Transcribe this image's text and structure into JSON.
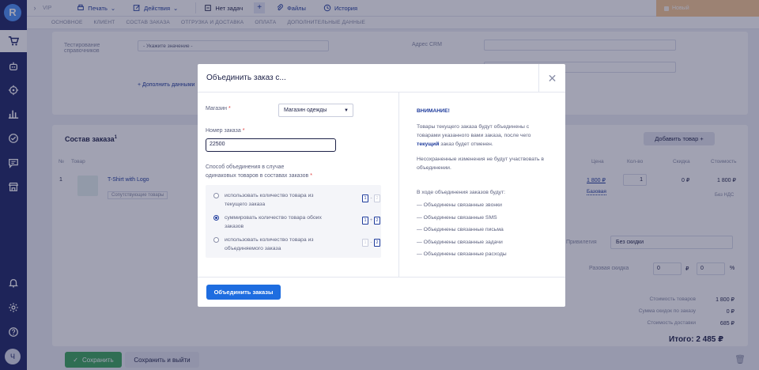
{
  "sidebar": {
    "logo": "R",
    "avatar": "Ч"
  },
  "topbar": {
    "sub_label": "VIP",
    "print_label": "Печать",
    "actions_label": "Действия",
    "tasks_label": "Нет задач",
    "files_label": "Файлы",
    "history_label": "История",
    "status_label": "Новый",
    "status_color": "#f6c993"
  },
  "tabs": [
    "ОСНОВНОЕ",
    "КЛИЕНТ",
    "СОСТАВ ЗАКАЗА",
    "ОТГРУЗКА И ДОСТАВКА",
    "ОПЛАТА",
    "ДОПОЛНИТЕЛЬНЫЕ ДАННЫЕ"
  ],
  "background": {
    "ref_label_1": "Тестирование",
    "ref_label_2": "справочников",
    "ref_select": "- Укажите значение -",
    "crm_label": "Адрес CRM",
    "add_data_link": "Дополнить данными",
    "order_section_title": "Состав заказа",
    "order_section_sup": "1",
    "add_product_button": "Добавить товар",
    "table_headers": {
      "no": "№",
      "product": "Товар",
      "price": "Цена",
      "qty": "Кол-во",
      "discount": "Скидка",
      "cost": "Стоимость"
    },
    "row": {
      "no": "1",
      "name": "T-Shirt with Logo",
      "tag": "Сопутствующие товары",
      "price": "1 800 ₽",
      "price_type": "Базовая",
      "qty": "1",
      "discount": "0 ₽",
      "cost": "1 800 ₽",
      "vat": "Без НДС"
    },
    "privilege_label": "Привилегия",
    "privilege_value": "Без скидки",
    "one_time_discount_label": "Разовая скидка",
    "discount_value": "0",
    "discount_currency": "₽",
    "discount_percent_value": "0",
    "discount_percent": "%",
    "totals": [
      {
        "label": "Стоимость товаров",
        "value": "1 800 ₽"
      },
      {
        "label": "Сумма скидок по заказу",
        "value": "0 ₽"
      },
      {
        "label": "Стоимость доставки",
        "value": "685 ₽"
      }
    ],
    "total_label": "Итого:",
    "total_value": "2 485 ₽",
    "save_button": "Сохранить",
    "save_exit_button": "Сохранить и выйти"
  },
  "modal": {
    "title": "Объединить заказ с...",
    "shop_label": "Магазин",
    "shop_value": "Магазин одежды",
    "order_number_label": "Номер заказа",
    "order_number_value": "22500",
    "method_label_1": "Способ объединения в случае",
    "method_label_2": "одинаковых товаров в составах заказов",
    "options": [
      {
        "text": "использовать количество товара из текущего заказа",
        "selected": false
      },
      {
        "text": "суммировать количество товара обоих заказов",
        "selected": true
      },
      {
        "text": "использовать количество товара из объединяемого заказа",
        "selected": false
      }
    ],
    "qty_digits": [
      "1",
      "2"
    ],
    "attention_title": "ВНИМАНИЕ!",
    "attention_p1_a": "Товары текущего заказа будут объединены с товарами указанного вами заказа, после чего",
    "attention_p1_bold": "текущий",
    "attention_p1_b": "заказ будет отменен.",
    "attention_p2": "Несохраненные изменения не будут участвовать в объединении.",
    "merge_list_title": "В ходе объединения заказов будут:",
    "merge_list": [
      "— Объединены связанные звонки",
      "— Объединены связанные SMS",
      "— Объединены связанные письма",
      "— Объединены связанные задачи",
      "— Объединены связанные расходы"
    ],
    "submit_button": "Объединить заказы",
    "accent_color": "#1e6de0"
  }
}
